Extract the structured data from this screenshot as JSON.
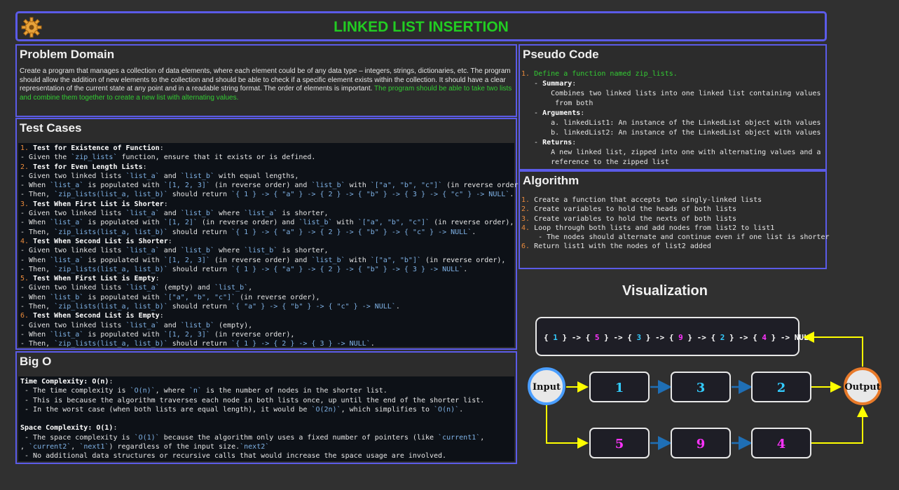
{
  "title": "LINKED LIST INSERTION",
  "problem": {
    "heading": "Problem Domain",
    "text": "Create a program that manages a collection of data elements, where each element could be of any data type – integers, strings, dictionaries, etc. The program should allow the addition of new elements to the collection and should be able to check if a specific element exists within the collection. It should have a clear representation of the current state at any point and in a readable string format. The order of elements is important.",
    "highlight": "The program should be able to take two lists and combine them together to create a new list with alternating values."
  },
  "tests": {
    "heading": "Test Cases",
    "lines": [
      {
        "n": "1.",
        "bold": "Test for Existence of Function",
        "rest": ":"
      },
      {
        "t": "- Given the ",
        "c": "`zip_lists`",
        "t2": " function, ensure that it exists or is defined."
      },
      {
        "n": "2.",
        "bold": "Test for Even Length Lists",
        "rest": ":"
      },
      {
        "t": "- Given two linked lists ",
        "c": "`list_a`",
        "t2": " and ",
        "c2": "`list_b`",
        "t3": " with equal lengths,"
      },
      {
        "t": "- When ",
        "c": "`list_a`",
        "t2": " is populated with ",
        "c2": "`[1, 2, 3]`",
        "t3": " (in reverse order) and ",
        "c3": "`list_b`",
        "t4": " with ",
        "c4": "`[\"a\", \"b\", \"c\"]`",
        "t5": " (in reverse order),"
      },
      {
        "t": "- Then, ",
        "c": "`zip_lists(list_a, list_b)`",
        "t2": " should return ",
        "c2": "`{ 1 } -> { \"a\" } -> { 2 } -> { \"b\" } -> { 3 } -> { \"c\" } -> NULL`",
        "t3": "."
      },
      {
        "n": "3.",
        "bold": "Test When First List is Shorter",
        "rest": ":"
      },
      {
        "t": "- Given two linked lists ",
        "c": "`list_a`",
        "t2": " and ",
        "c2": "`list_b`",
        "t3": " where ",
        "c3": "`list_a`",
        "t4": " is shorter,"
      },
      {
        "t": "- When ",
        "c": "`list_a`",
        "t2": " is populated with ",
        "c2": "`[1, 2]`",
        "t3": " (in reverse order) and ",
        "c3": "`list_b`",
        "t4": " with ",
        "c4": "`[\"a\", \"b\", \"c\"]`",
        "t5": " (in reverse order),"
      },
      {
        "t": "- Then, ",
        "c": "`zip_lists(list_a, list_b)`",
        "t2": " should return ",
        "c2": "`{ 1 } -> { \"a\" } -> { 2 } -> { \"b\" } -> { \"c\" } -> NULL`",
        "t3": "."
      },
      {
        "n": "4.",
        "bold": "Test When Second List is Shorter",
        "rest": ":"
      },
      {
        "t": "- Given two linked lists ",
        "c": "`list_a`",
        "t2": " and ",
        "c2": "`list_b`",
        "t3": " where ",
        "c3": "`list_b`",
        "t4": " is shorter,"
      },
      {
        "t": "- When ",
        "c": "`list_a`",
        "t2": " is populated with ",
        "c2": "`[1, 2, 3]`",
        "t3": " (in reverse order) and ",
        "c3": "`list_b`",
        "t4": " with ",
        "c4": "`[\"a\", \"b\"]`",
        "t5": " (in reverse order),"
      },
      {
        "t": "- Then, ",
        "c": "`zip_lists(list_a, list_b)`",
        "t2": " should return ",
        "c2": "`{ 1 } -> { \"a\" } -> { 2 } -> { \"b\" } -> { 3 } -> NULL`",
        "t3": "."
      },
      {
        "n": "5.",
        "bold": "Test When First List is Empty",
        "rest": ":"
      },
      {
        "t": "- Given two linked lists ",
        "c": "`list_a`",
        "t2": " (empty) and ",
        "c2": "`list_b`",
        "t3": ","
      },
      {
        "t": "- When ",
        "c": "`list_b`",
        "t2": " is populated with ",
        "c2": "`[\"a\", \"b\", \"c\"]`",
        "t3": " (in reverse order),"
      },
      {
        "t": "- Then, ",
        "c": "`zip_lists(list_a, list_b)`",
        "t2": " should return ",
        "c2": "`{ \"a\" } -> { \"b\" } -> { \"c\" } -> NULL`",
        "t3": "."
      },
      {
        "n": "6.",
        "bold": "Test When Second List is Empty",
        "rest": ":"
      },
      {
        "t": "- Given two linked lists ",
        "c": "`list_a`",
        "t2": " and ",
        "c2": "`list_b`",
        "t3": " (empty),"
      },
      {
        "t": "- When ",
        "c": "`list_a`",
        "t2": " is populated with ",
        "c2": "`[1, 2, 3]`",
        "t3": " (in reverse order),"
      },
      {
        "t": "- Then, ",
        "c": "`zip_lists(list_a, list_b)`",
        "t2": " should return ",
        "c2": "`{ 1 } -> { 2 } -> { 3 } -> NULL`",
        "t3": "."
      }
    ]
  },
  "bigo": {
    "heading": "Big O",
    "lines": [
      {
        "bold": "Time Complexity: O(n)",
        "rest": ":"
      },
      {
        "t": " - The time complexity is ",
        "c": "`O(n)`",
        "t2": ", where ",
        "c2": "`n`",
        "t3": " is the number of nodes in the shorter list."
      },
      {
        "t": " - This is because the algorithm traverses each node in both lists once, up until the end of the shorter list."
      },
      {
        "t": " - In the worst case (when both lists are equal length), it would be ",
        "c": "`O(2n)`",
        "t2": ", which simplifies to ",
        "c2": "`O(n)`",
        "t3": "."
      },
      {
        "t": ""
      },
      {
        "bold": "Space Complexity: O(1)",
        "rest": ":"
      },
      {
        "t": " - The space complexity is ",
        "c": "`O(1)`",
        "t2": " because the algorithm only uses a fixed number of pointers (like ",
        "c2": "`current1`",
        "t3": ","
      },
      {
        "c": "`current2`",
        "t": ", ",
        "c2": "`next1`",
        "t2": ", ",
        "c3": "`next2`",
        "t3": ") regardless of the input size."
      },
      {
        "t": " - No additional data structures or recursive calls that would increase the space usage are involved."
      }
    ]
  },
  "pseudo": {
    "heading": "Pseudo Code",
    "lines": [
      {
        "n": "1.",
        "g": "Define a function named zip_lists."
      },
      {
        "t": "   - ",
        "bold": "Summary",
        "rest": ":"
      },
      {
        "t": "       Combines two linked lists into one linked list containing values"
      },
      {
        "t": "        from both"
      },
      {
        "t": "   - ",
        "bold": "Arguments",
        "rest": ":"
      },
      {
        "t": "       a. linkedList1: An instance of the LinkedList object with values"
      },
      {
        "t": "       b. linkedList2: An instance of the LinkedList object with values"
      },
      {
        "t": "   - ",
        "bold": "Returns",
        "rest": ":"
      },
      {
        "t": "       A new linked list, zipped into one with alternating values and a"
      },
      {
        "t": "       reference to the zipped list"
      }
    ]
  },
  "algorithm": {
    "heading": "Algorithm",
    "lines": [
      {
        "n": "1.",
        "t": "Create a function that accepts two singly-linked lists"
      },
      {
        "n": "2.",
        "t": "Create variables to hold the heads of both lists"
      },
      {
        "n": "3.",
        "t": "Create variables to hold the nexts of both lists"
      },
      {
        "n": "4.",
        "t": "Loop through both lists and add nodes from list2 to list1"
      },
      {
        "t": "    - The nodes should alternate and continue even if one list is shorter"
      },
      {
        "n": "6.",
        "t": "Return list1 with the nodes of list2 added"
      }
    ]
  },
  "viz": {
    "title": "Visualization",
    "result": [
      {
        "v": "1",
        "color": "#33ccff"
      },
      {
        "v": "5",
        "color": "#ff33ff"
      },
      {
        "v": "3",
        "color": "#33ccff"
      },
      {
        "v": "9",
        "color": "#ff33ff"
      },
      {
        "v": "2",
        "color": "#33ccff"
      },
      {
        "v": "4",
        "color": "#ff33ff"
      }
    ],
    "null_label": "NULL",
    "input_label": "Input",
    "output_label": "Output",
    "list1": [
      "1",
      "3",
      "2"
    ],
    "list2": [
      "5",
      "9",
      "4"
    ],
    "colors": {
      "list1": "#33ccff",
      "list2": "#ff33ff",
      "arrow": "#ffff00",
      "link": "#1f6fb5",
      "input_ring": "#4a9eff",
      "output_ring": "#e87a2a"
    }
  }
}
